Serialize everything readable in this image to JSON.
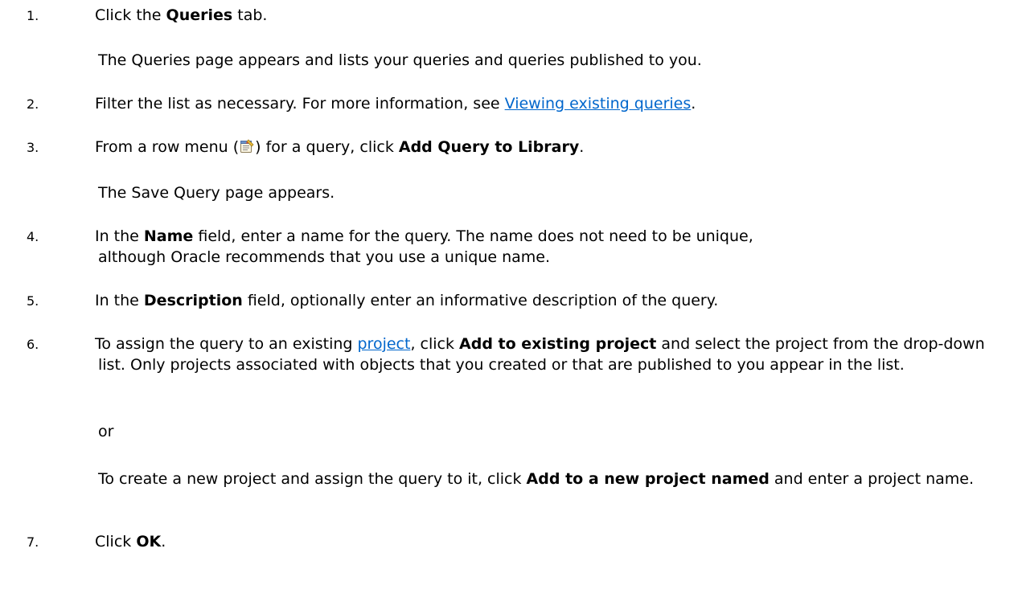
{
  "steps": [
    {
      "number": "1.",
      "before": "Click the ",
      "bold": "Queries",
      "after": " tab."
    },
    {
      "number": "2.",
      "before": "Filter the list as necessary. For more information, see ",
      "link": "Viewing existing queries",
      "after": "."
    },
    {
      "number": "3.",
      "before": "From a row menu (",
      "icon": "row-menu-icon",
      "middle": ") for a query, click ",
      "bold": "Add Query to Library",
      "after": "."
    },
    {
      "number": "4.",
      "before": "In the ",
      "bold": "Name",
      "after": " field, enter a name for the query. The name does not need to be unique, although Oracle recommends that you use a unique name."
    },
    {
      "number": "5.",
      "before": "In the ",
      "bold": "Description",
      "after": " field, optionally enter an informative description of the query."
    },
    {
      "number": "6.",
      "before": "To assign the query to an existing ",
      "link": "project",
      "middle": ", click ",
      "bold": "Add to existing project",
      "after": " and select the project from the drop-down list. Only projects associated with objects that you created or that are published to you appear in the list."
    },
    {
      "number": "7.",
      "before": "Click ",
      "bold": "OK",
      "after": "."
    }
  ],
  "paragraphs": {
    "queries_result": "The Queries page appears and lists your queries and queries published to you.",
    "save_query_result": "The Save Query page appears.",
    "or": "or",
    "new_project_before": "To create a new project and assign the query to it, click ",
    "new_project_bold": "Add to a new project named",
    "new_project_after": " and enter a project name."
  },
  "colors": {
    "link": "#0066cc",
    "text": "#000000",
    "background": "#ffffff"
  }
}
